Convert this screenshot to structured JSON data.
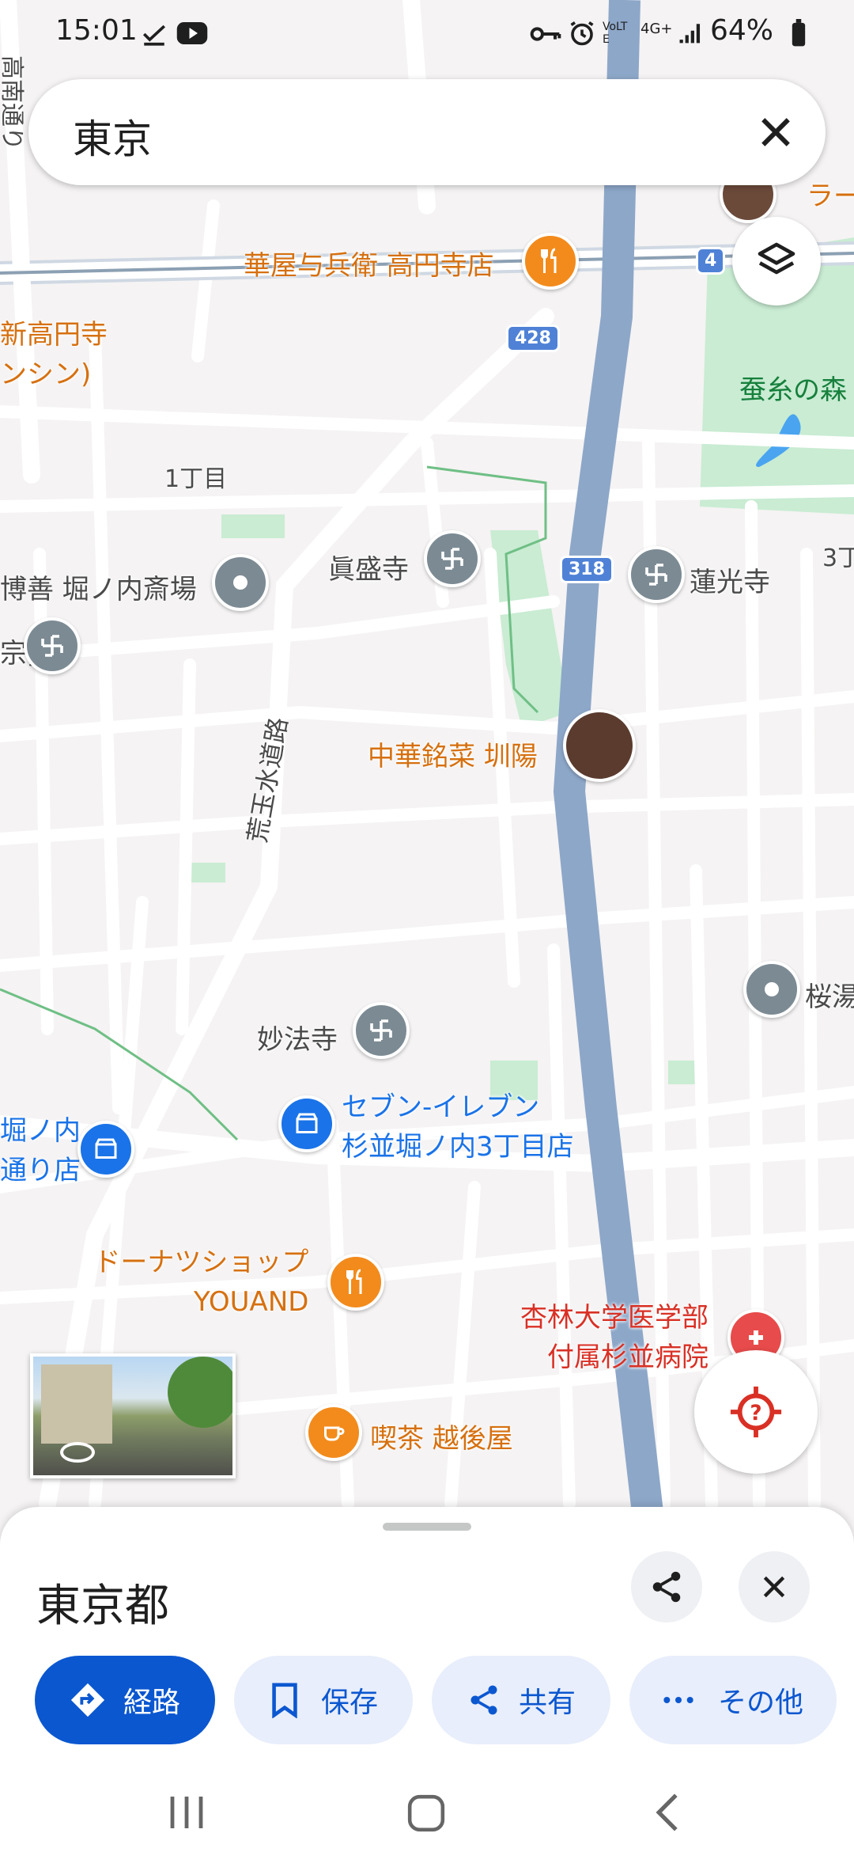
{
  "status_bar": {
    "time": "15:01",
    "battery": "64%",
    "network": "4G+",
    "volte": "VoLTE"
  },
  "search": {
    "query": "東京"
  },
  "map": {
    "labels": {
      "street_left": "高南通り",
      "restaurant_1": "華屋与兵衛 高円寺店",
      "route_4": "4",
      "ramen_partial": "ラー",
      "temple_partial_1": "新高円寺",
      "temple_partial_2": "ンシン)",
      "route_428": "428",
      "park": "蚕糸の森",
      "chome_1": "1丁目",
      "temple_shinsei": "眞盛寺",
      "route_318": "318",
      "temple_renko": "蓮光寺",
      "chome_3": "3丁",
      "funeral": "博善 堀ノ内斎場",
      "left_partial": "宗]",
      "waterworks_road": "荒玉水道路",
      "chinese_restaurant": "中華銘菜 圳陽",
      "sento": "桜湯",
      "temple_myoho": "妙法寺",
      "seven_line1": "セブン-イレブン",
      "seven_line2": "杉並堀ノ内3丁目店",
      "left_store_line1": "堀ノ内",
      "left_store_line2": "通り店",
      "donut_line1": "ドーナツショップ",
      "donut_line2": "YOUAND",
      "hospital_line1": "杏林大学医学部",
      "hospital_line2": "付属杉並病院",
      "cafe": "喫茶 越後屋"
    }
  },
  "place_sheet": {
    "title": "東京都",
    "buttons": {
      "directions": "経路",
      "save": "保存",
      "share": "共有",
      "more": "その他"
    }
  },
  "colors": {
    "primary": "#0b57d0",
    "road": "#ffffff",
    "highway": "#8da7c9",
    "park": "#c9ecd3",
    "poi_orange": "#f28b1c",
    "poi_gray": "#7c8a93",
    "poi_blue": "#1a73e8"
  }
}
